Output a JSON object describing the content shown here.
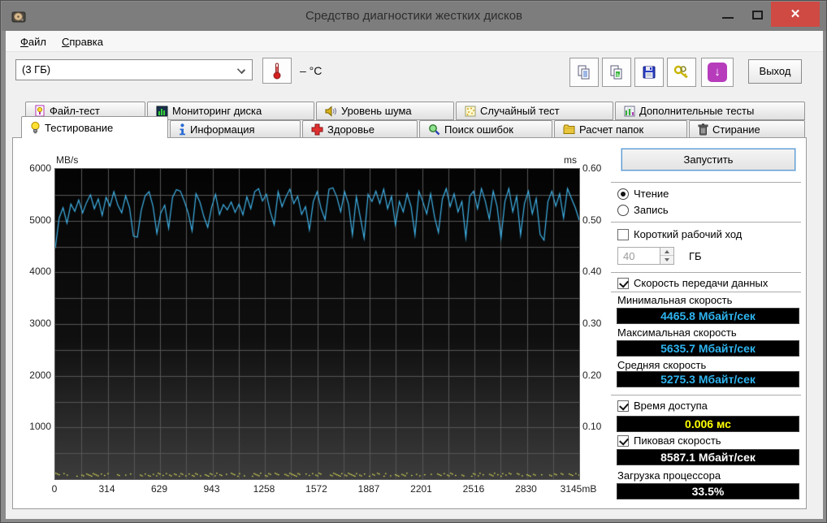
{
  "window": {
    "title": "Средство диагностики жестких дисков",
    "close_glyph": "✕"
  },
  "menu": {
    "items": [
      "Файл",
      "Справка"
    ]
  },
  "toolbar": {
    "capacity_dropdown": {
      "value": "(3 ГБ)"
    },
    "temperature_value": "– °C",
    "exit_label": "Выход",
    "download_glyph": "↓"
  },
  "tabs": {
    "row1": [
      {
        "label": "Файл-тест"
      },
      {
        "label": "Мониторинг диска"
      },
      {
        "label": "Уровень шума"
      },
      {
        "label": "Случайный тест"
      },
      {
        "label": "Дополнительные тесты"
      }
    ],
    "row2": [
      {
        "label": "Тестирование",
        "active": true
      },
      {
        "label": "Информация"
      },
      {
        "label": "Здоровье"
      },
      {
        "label": "Поиск ошибок"
      },
      {
        "label": "Расчет папок"
      },
      {
        "label": "Стирание"
      }
    ]
  },
  "benchmark_panel": {
    "start_button": "Запустить",
    "mode": {
      "read_label": "Чтение",
      "write_label": "Запись",
      "selected": "read"
    },
    "short_stroke": {
      "label": "Короткий рабочий ход",
      "checked": false,
      "size_value": "40",
      "size_unit": "ГБ"
    },
    "transfer": {
      "label": "Скорость передачи данных",
      "checked": true,
      "min_label": "Минимальная скорость",
      "min_value": "4465.8 Мбайт/сек",
      "max_label": "Максимальная скорость",
      "max_value": "5635.7 Мбайт/сек",
      "avg_label": "Средняя скорость",
      "avg_value": "5275.3 Мбайт/сек"
    },
    "access_time": {
      "label": "Время доступа",
      "checked": true,
      "value": "0.006 мс"
    },
    "burst_rate": {
      "label": "Пиковая скорость",
      "checked": true,
      "value": "8587.1 Мбайт/сек"
    },
    "cpu_usage": {
      "label": "Загрузка процессора",
      "value": "33.5%"
    }
  },
  "chart_data": {
    "type": "line",
    "ylabel_left": "MB/s",
    "ylabel_right": "ms",
    "ylim_left": [
      0,
      6000
    ],
    "ylim_right": [
      0,
      0.6
    ],
    "xlim_mb": [
      0,
      3145
    ],
    "y_ticks_left": [
      "6000",
      "5000",
      "4000",
      "3000",
      "2000",
      "1000"
    ],
    "y_ticks_right": [
      "0.60",
      "0.50",
      "0.40",
      "0.30",
      "0.20",
      "0.10"
    ],
    "x_ticks": [
      "0",
      "314",
      "629",
      "943",
      "1258",
      "1572",
      "1887",
      "2201",
      "2516",
      "2830",
      "3145mB"
    ],
    "grid": true,
    "background": "black-gradient",
    "series": [
      {
        "name": "transfer-rate-mbs",
        "color": "#3fb2e8",
        "values": [
          4466,
          5050,
          5250,
          4950,
          5320,
          5180,
          5400,
          5150,
          5350,
          5500,
          5230,
          5420,
          5100,
          5450,
          5280,
          5560,
          5300,
          5150,
          5480,
          5250,
          4700,
          4680,
          5200,
          5480,
          5560,
          5280,
          4750,
          5150,
          5300,
          4850,
          5450,
          5600,
          5570,
          5380,
          5150,
          4800,
          5520,
          5360,
          5080,
          4870,
          5260,
          5510,
          5120,
          5310,
          5210,
          5360,
          5160,
          5320,
          5110,
          5460,
          5230,
          5560,
          5620,
          5380,
          5510,
          5170,
          4920,
          5560,
          5270,
          5460,
          5610,
          5330,
          5470,
          5120,
          5270,
          4820,
          5370,
          5560,
          5230,
          5020,
          5610,
          5636,
          5460,
          5170,
          5560,
          5320,
          4720,
          5460,
          5070,
          4660,
          5510,
          5370,
          5570,
          5330,
          5610,
          5230,
          5470,
          4920,
          5370,
          5170,
          5520,
          5270,
          4720,
          5570,
          5370,
          5130,
          5520,
          5070,
          4770,
          5420,
          5620,
          5270,
          5520,
          5170,
          5370,
          4670,
          5470,
          5570,
          5230,
          5620,
          5370,
          5030,
          5570,
          5270,
          4660,
          5370,
          5620,
          5170,
          5470,
          4720,
          5330,
          5570,
          5130,
          5430,
          4730,
          4620,
          5370,
          5570,
          5280,
          5520,
          5050,
          5620,
          5430,
          5250,
          5010
        ]
      },
      {
        "name": "access-time-ms",
        "color": "#e9e95a",
        "style": "dots",
        "value_ms": 0.006
      }
    ]
  }
}
